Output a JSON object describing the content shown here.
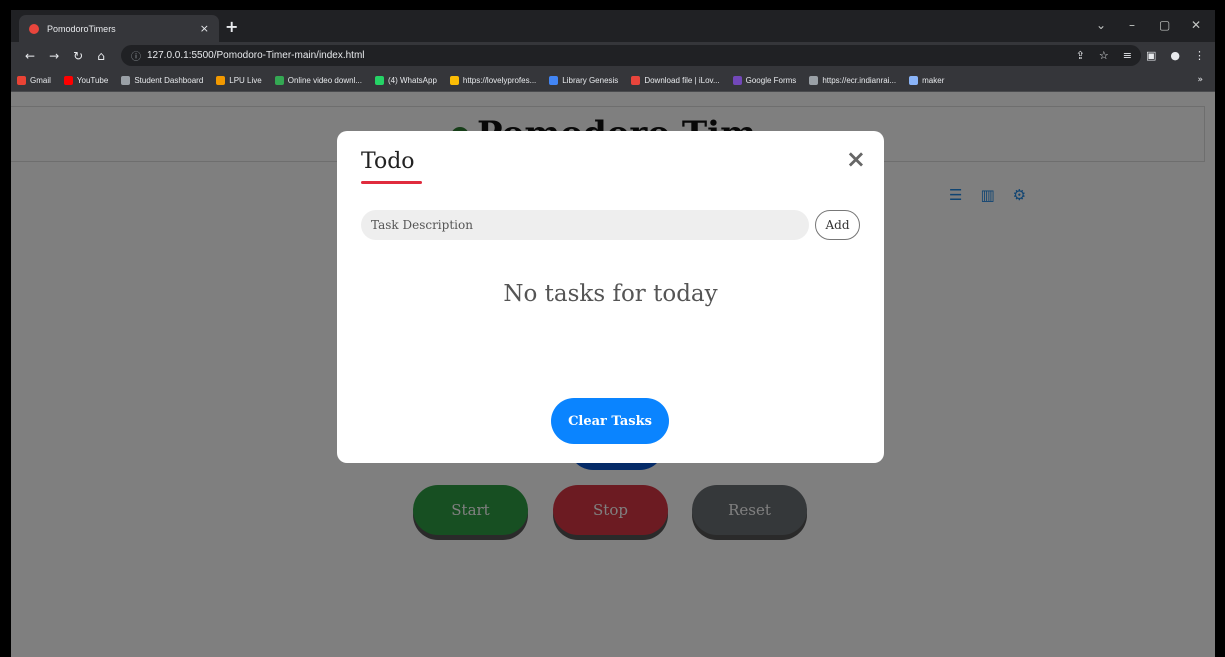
{
  "browser": {
    "tab_title": "PomodoroTimers",
    "tab_close": "×",
    "new_tab": "+",
    "window_controls": [
      "⌄",
      "–",
      "▢",
      "✕"
    ],
    "url": "127.0.0.1:5500/Pomodoro-Timer-main/index.html",
    "bookmarks": [
      {
        "label": "Gmail",
        "color": "#ea4335"
      },
      {
        "label": "YouTube",
        "color": "#ff0000"
      },
      {
        "label": "Student Dashboard",
        "color": "#9aa0a6"
      },
      {
        "label": "LPU Live",
        "color": "#f29900"
      },
      {
        "label": "Online video downl...",
        "color": "#34a853"
      },
      {
        "label": "(4) WhatsApp",
        "color": "#25d366"
      },
      {
        "label": "https://lovelyprofes...",
        "color": "#fbbc04"
      },
      {
        "label": "Library Genesis",
        "color": "#4285f4"
      },
      {
        "label": "Download file | iLov...",
        "color": "#e8453c"
      },
      {
        "label": "Google Forms",
        "color": "#7248b9"
      },
      {
        "label": "https://ecr.indianrai...",
        "color": "#9aa0a6"
      },
      {
        "label": "maker",
        "color": "#8ab4f8"
      }
    ],
    "bookmarks_more": "»"
  },
  "page": {
    "title": "Pomodoro Tim",
    "controls": {
      "start": "Start",
      "stop": "Stop",
      "reset": "Reset"
    }
  },
  "modal": {
    "title": "Todo",
    "close": "×",
    "input_placeholder": "Task Description",
    "add_label": "Add",
    "empty_message": "No tasks for today",
    "clear_label": "Clear Tasks"
  },
  "colors": {
    "accent_underline": "#e02b3d",
    "clear_button": "#0a84ff",
    "start": "#2e9e44",
    "stop": "#d93645",
    "reset": "#6b7075"
  }
}
